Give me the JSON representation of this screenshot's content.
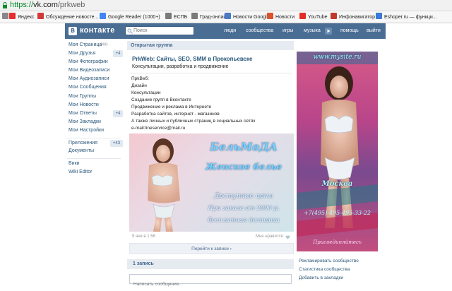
{
  "browser": {
    "url_scheme": "https://",
    "url_host": "vk.com",
    "url_path": "/prkweb",
    "bookmarks": [
      {
        "label": "",
        "icon": "apps-icon",
        "color": "#888888"
      },
      {
        "label": "Яндекс",
        "icon": "yandex-icon",
        "color": "#e62e2e"
      },
      {
        "label": "Обсуждение новосте...",
        "icon": "bookmark-icon",
        "color": "#d43a3a"
      },
      {
        "label": "Google Reader (1000+)",
        "icon": "google-icon",
        "color": "#4285f4"
      },
      {
        "label": "ЕСПБ",
        "icon": "page-icon",
        "color": "#7a7a7a"
      },
      {
        "label": "Град-онлайн",
        "icon": "page-icon",
        "color": "#7a7a7a"
      },
      {
        "label": "Новости Google",
        "icon": "news-icon",
        "color": "#4a7ac8"
      },
      {
        "label": "Новости",
        "icon": "news-icon",
        "color": "#d9532c"
      },
      {
        "label": "YouTube",
        "icon": "youtube-icon",
        "color": "#e52d27"
      },
      {
        "label": "Инфонавигатор",
        "icon": "info-icon",
        "color": "#c0392b"
      },
      {
        "label": "Eshoper.ru — функци...",
        "icon": "page-icon",
        "color": "#3a7bd5"
      }
    ]
  },
  "header": {
    "logo_letter": "В",
    "logo_text": "контакте",
    "search_placeholder": "Поиск",
    "nav": [
      "люди",
      "сообщества",
      "игры",
      "музыка",
      "помощь",
      "выйти"
    ]
  },
  "sidebar": {
    "edit_label": "ред.",
    "items": [
      {
        "label": "Моя Страница"
      },
      {
        "label": "Мои Друзья",
        "badge": "+4"
      },
      {
        "label": "Мои Фотографии"
      },
      {
        "label": "Мои Видеозаписи"
      },
      {
        "label": "Мои Аудиозаписи"
      },
      {
        "label": "Мои Сообщения"
      },
      {
        "label": "Мои Группы"
      },
      {
        "label": "Мои Новости"
      },
      {
        "label": "Мои Ответы",
        "badge": "+4"
      },
      {
        "label": "Мои Закладки"
      },
      {
        "label": "Мои Настройки"
      },
      {
        "label": "Приложения",
        "badge": "+43"
      },
      {
        "label": "Документы"
      },
      {
        "label": "Вики"
      },
      {
        "label": "Wiki Editor"
      }
    ]
  },
  "group": {
    "type_label": "Открытая группа",
    "title": "PrkWeb: Сайты, SEO, SMM в Прокопьевске",
    "status": "Консультации, разработка и продвижение",
    "description": [
      "ПрkВеб:",
      "Дизайн",
      "Консультации",
      "Создание групп в Вконтакте",
      "Продвижение и реклама в Интернете",
      "Разработка сайтов, интернет - магазинов",
      "А также личных и публичных страниц в социальных сетях",
      "e-mail:lineservice@mail.ru"
    ]
  },
  "post": {
    "image_title": "БельМоДА",
    "image_subtitle": "Женское белье",
    "image_line1": "Доступные цены",
    "image_line2": "При заказе от 2000 р.",
    "image_line3": "бесплатная доставка",
    "date": "9 янв в 1:56",
    "like_label": "Мне нравится",
    "goto_wall": "Перейти к записи",
    "wall_count": "1 запись",
    "comment_placeholder": "Написать сообщение..."
  },
  "banner": {
    "url": "www.mysite.ru",
    "city": "Москва",
    "phone": "+7(495)-495-495-33-22",
    "join": "Присоединяйтесь"
  },
  "right_links": [
    "Рекламировать сообщество",
    "Статистика сообщества",
    "Добавить в закладки"
  ]
}
